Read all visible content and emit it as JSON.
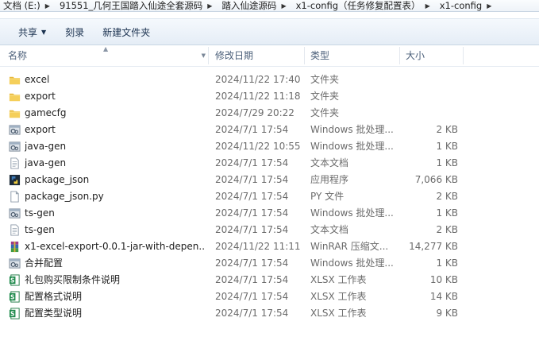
{
  "breadcrumb": [
    "文档 (E:)",
    "91551_几何王国踏入仙途全套源码",
    "踏入仙途源码",
    "x1-config（任务修复配置表）",
    "x1-config"
  ],
  "toolbar": {
    "share": "共享",
    "burn": "刻录",
    "new_folder": "新建文件夹"
  },
  "columns": {
    "name": "名称",
    "date": "修改日期",
    "type": "类型",
    "size": "大小"
  },
  "files": [
    {
      "name": "excel",
      "date": "2024/11/22 17:40",
      "type": "文件夹",
      "size": "",
      "icon": "folder-icon"
    },
    {
      "name": "export",
      "date": "2024/11/22 11:18",
      "type": "文件夹",
      "size": "",
      "icon": "folder-icon"
    },
    {
      "name": "gamecfg",
      "date": "2024/7/29 20:22",
      "type": "文件夹",
      "size": "",
      "icon": "folder-icon"
    },
    {
      "name": "export",
      "date": "2024/7/1 17:54",
      "type": "Windows 批处理...",
      "size": "2 KB",
      "icon": "batch-file-icon"
    },
    {
      "name": "java-gen",
      "date": "2024/11/22 10:55",
      "type": "Windows 批处理...",
      "size": "1 KB",
      "icon": "batch-file-icon"
    },
    {
      "name": "java-gen",
      "date": "2024/7/1 17:54",
      "type": "文本文档",
      "size": "1 KB",
      "icon": "text-file-icon"
    },
    {
      "name": "package_json",
      "date": "2024/7/1 17:54",
      "type": "应用程序",
      "size": "7,066 KB",
      "icon": "python-exe-icon"
    },
    {
      "name": "package_json.py",
      "date": "2024/7/1 17:54",
      "type": "PY 文件",
      "size": "2 KB",
      "icon": "blank-file-icon"
    },
    {
      "name": "ts-gen",
      "date": "2024/7/1 17:54",
      "type": "Windows 批处理...",
      "size": "1 KB",
      "icon": "batch-file-icon"
    },
    {
      "name": "ts-gen",
      "date": "2024/7/1 17:54",
      "type": "文本文档",
      "size": "2 KB",
      "icon": "text-file-icon"
    },
    {
      "name": "x1-excel-export-0.0.1-jar-with-depen...",
      "date": "2024/11/22 11:11",
      "type": "WinRAR 压缩文...",
      "size": "14,277 KB",
      "icon": "winrar-archive-icon"
    },
    {
      "name": "合并配置",
      "date": "2024/7/1 17:54",
      "type": "Windows 批处理...",
      "size": "1 KB",
      "icon": "batch-file-icon"
    },
    {
      "name": "礼包购买限制条件说明",
      "date": "2024/7/1 17:54",
      "type": "XLSX 工作表",
      "size": "10 KB",
      "icon": "xlsx-file-icon"
    },
    {
      "name": "配置格式说明",
      "date": "2024/7/1 17:54",
      "type": "XLSX 工作表",
      "size": "14 KB",
      "icon": "xlsx-file-icon"
    },
    {
      "name": "配置类型说明",
      "date": "2024/7/1 17:54",
      "type": "XLSX 工作表",
      "size": "9 KB",
      "icon": "xlsx-file-icon"
    }
  ]
}
